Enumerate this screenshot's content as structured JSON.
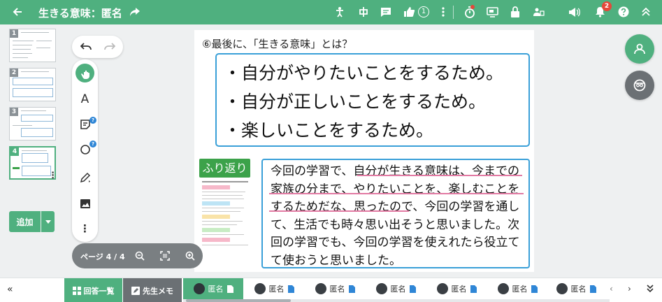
{
  "header": {
    "title": "生きる意味：匿名",
    "like_count": "1",
    "notification_count": "2"
  },
  "thumbnails": {
    "pages": [
      "1",
      "2",
      "3",
      "4"
    ],
    "add_label": "追加"
  },
  "content": {
    "question": "⑥最後に、「生きる意味」とは？",
    "answers": [
      "・自分がやりたいことをするため。",
      "・自分が正しいことをするため。",
      "・楽しいことをするため。"
    ],
    "reflection_label": "ふり返り",
    "reflection_text": "今回の学習で、自分が生きる意味は、今までの家族の分まで、やりたいことを、楽しむことをするためだな、思ったので、今回の学習を通して、生活でも時々思い出そうと思いました。次回の学習でも、今回の学習を使えれたら役立てて使おうと思いました。"
  },
  "page_bar": {
    "label": "ページ 4 / 4"
  },
  "bottom": {
    "answers_label": "回答一覧",
    "memo_label": "先生メモ",
    "students": [
      "匿名",
      "匿名",
      "匿名",
      "匿名",
      "匿名",
      "匿名",
      "匿名"
    ]
  },
  "colors": {
    "accent": "#4fb07f",
    "frame_blue": "#3aa0d8",
    "highlight_pink": "#e27aa3",
    "badge_red": "#e5483a"
  }
}
